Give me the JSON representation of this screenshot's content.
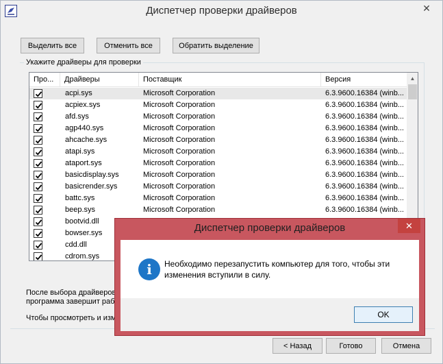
{
  "window": {
    "title": "Диспетчер проверки драйверов",
    "close_glyph": "✕"
  },
  "toolbar": {
    "select_all": "Выделить все",
    "deselect_all": "Отменить все",
    "invert_selection": "Обратить выделение"
  },
  "group": {
    "label": "Укажите драйверы для проверки"
  },
  "table": {
    "columns": [
      "Про...",
      "Драйверы",
      "Поставщик",
      "Версия"
    ],
    "rows": [
      {
        "checked": true,
        "driver": "acpi.sys",
        "vendor": "Microsoft Corporation",
        "version": "6.3.9600.16384 (winb..."
      },
      {
        "checked": true,
        "driver": "acpiex.sys",
        "vendor": "Microsoft Corporation",
        "version": "6.3.9600.16384 (winb..."
      },
      {
        "checked": true,
        "driver": "afd.sys",
        "vendor": "Microsoft Corporation",
        "version": "6.3.9600.16384 (winb..."
      },
      {
        "checked": true,
        "driver": "agp440.sys",
        "vendor": "Microsoft Corporation",
        "version": "6.3.9600.16384 (winb..."
      },
      {
        "checked": true,
        "driver": "ahcache.sys",
        "vendor": "Microsoft Corporation",
        "version": "6.3.9600.16384 (winb..."
      },
      {
        "checked": true,
        "driver": "atapi.sys",
        "vendor": "Microsoft Corporation",
        "version": "6.3.9600.16384 (winb..."
      },
      {
        "checked": true,
        "driver": "ataport.sys",
        "vendor": "Microsoft Corporation",
        "version": "6.3.9600.16384 (winb..."
      },
      {
        "checked": true,
        "driver": "basicdisplay.sys",
        "vendor": "Microsoft Corporation",
        "version": "6.3.9600.16384 (winb..."
      },
      {
        "checked": true,
        "driver": "basicrender.sys",
        "vendor": "Microsoft Corporation",
        "version": "6.3.9600.16384 (winb..."
      },
      {
        "checked": true,
        "driver": "battc.sys",
        "vendor": "Microsoft Corporation",
        "version": "6.3.9600.16384 (winb..."
      },
      {
        "checked": true,
        "driver": "beep.sys",
        "vendor": "Microsoft Corporation",
        "version": "6.3.9600.16384 (winb..."
      },
      {
        "checked": true,
        "driver": "bootvid.dll",
        "vendor": "",
        "version": ""
      },
      {
        "checked": true,
        "driver": "bowser.sys",
        "vendor": "",
        "version": ""
      },
      {
        "checked": true,
        "driver": "cdd.dll",
        "vendor": "",
        "version": ""
      },
      {
        "checked": true,
        "driver": "cdrom.sys",
        "vendor": "",
        "version": ""
      }
    ]
  },
  "notes": {
    "line1": "После выбора драйверов",
    "line2": "программа завершит рабо",
    "line3": "Чтобы просмотреть и изм"
  },
  "footer": {
    "back": "< Назад",
    "finish": "Готово",
    "cancel": "Отмена"
  },
  "dialog": {
    "title": "Диспетчер проверки драйверов",
    "close_glyph": "✕",
    "icon_glyph": "i",
    "message": "Необходимо перезапустить компьютер для того, чтобы эти изменения вступили в силу.",
    "ok": "OK",
    "frame_color": "#c8575f",
    "info_color": "#1e76c7"
  }
}
